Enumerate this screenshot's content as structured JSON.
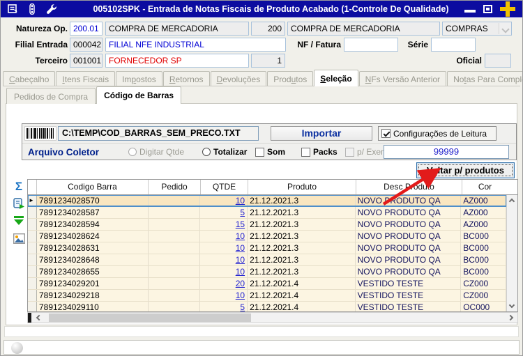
{
  "window": {
    "title": "005102SPK - Entrada de Notas Fiscais de Produto Acabado (1-Controle De Qualidade)"
  },
  "form": {
    "natureza": {
      "label": "Natureza Op.",
      "code": "200.01",
      "desc": "COMPRA DE MERCADORIA",
      "code2": "200",
      "desc2": "COMPRA DE MERCADORIA",
      "tipo": "COMPRAS"
    },
    "filial": {
      "label": "Filial Entrada",
      "code": "000042",
      "desc": "FILIAL NFE INDUSTRIAL"
    },
    "terceiro": {
      "label": "Terceiro",
      "code": "001001",
      "desc": "FORNECEDOR SP",
      "seq": "1"
    },
    "nf_fatura": {
      "label": "NF / Fatura",
      "value": ""
    },
    "serie": {
      "label": "Série",
      "value": ""
    },
    "oficial": {
      "label": "Oficial",
      "value": ""
    }
  },
  "tabs": [
    {
      "label": "Cabeçalho",
      "accel": 0,
      "name": "tab-cabecalho"
    },
    {
      "label": "Itens Fiscais",
      "accel": 0,
      "name": "tab-itens-fiscais"
    },
    {
      "label": "Impostos",
      "accel": 2,
      "name": "tab-impostos"
    },
    {
      "label": "Retornos",
      "accel": 0,
      "name": "tab-retornos"
    },
    {
      "label": "Devoluções",
      "accel": 0,
      "name": "tab-devolucoes"
    },
    {
      "label": "Produtos",
      "accel": 4,
      "name": "tab-produtos"
    },
    {
      "label": "Seleção",
      "accel": 0,
      "name": "tab-selecao",
      "active": true
    },
    {
      "label": "NFs Versão Anterior",
      "accel": 0,
      "name": "tab-nfs-versao-anterior"
    },
    {
      "label": "Notas Para Complemento",
      "accel": 2,
      "name": "tab-notas-para-complemento"
    }
  ],
  "subtabs": [
    {
      "label": "Pedidos de Compra",
      "name": "subtab-pedidos-de-compra"
    },
    {
      "label": "Código de Barras",
      "name": "subtab-codigo-de-barras",
      "active": true
    }
  ],
  "barcode_panel": {
    "path": "C:\\TEMP\\COD_BARRAS_SEM_PRECO.TXT",
    "import_label": "Importar",
    "config_label": "Configurações de Leitura",
    "config_checked": true,
    "coletor_label": "Arquivo Coletor",
    "radio_digitar": "Digitar Qtde",
    "radio_totalizar": "Totalizar",
    "check_som": "Som",
    "check_packs": "Packs",
    "check_exemplar": "p/ Exemplar",
    "quantity": "99999"
  },
  "voltar_label": "Voltar p/ produtos",
  "table": {
    "columns": [
      "Codigo Barra",
      "Pedido",
      "QTDE",
      "Produto",
      "Desc Produto",
      "Cor"
    ],
    "rows": [
      {
        "codigo": "7891234028570",
        "pedido": "",
        "qtde": "10",
        "produto": "21.12.2021.3",
        "desc": "NOVO PRODUTO QA",
        "cor": "AZ000",
        "selected": true
      },
      {
        "codigo": "7891234028587",
        "pedido": "",
        "qtde": "5",
        "produto": "21.12.2021.3",
        "desc": "NOVO PRODUTO QA",
        "cor": "AZ000"
      },
      {
        "codigo": "7891234028594",
        "pedido": "",
        "qtde": "15",
        "produto": "21.12.2021.3",
        "desc": "NOVO PRODUTO QA",
        "cor": "AZ000"
      },
      {
        "codigo": "7891234028624",
        "pedido": "",
        "qtde": "10",
        "produto": "21.12.2021.3",
        "desc": "NOVO PRODUTO QA",
        "cor": "BC000"
      },
      {
        "codigo": "7891234028631",
        "pedido": "",
        "qtde": "10",
        "produto": "21.12.2021.3",
        "desc": "NOVO PRODUTO QA",
        "cor": "BC000"
      },
      {
        "codigo": "7891234028648",
        "pedido": "",
        "qtde": "10",
        "produto": "21.12.2021.3",
        "desc": "NOVO PRODUTO QA",
        "cor": "BC000"
      },
      {
        "codigo": "7891234028655",
        "pedido": "",
        "qtde": "10",
        "produto": "21.12.2021.3",
        "desc": "NOVO PRODUTO QA",
        "cor": "BC000"
      },
      {
        "codigo": "7891234029201",
        "pedido": "",
        "qtde": "20",
        "produto": "21.12.2021.4",
        "desc": "VESTIDO TESTE",
        "cor": "CZ000"
      },
      {
        "codigo": "7891234029218",
        "pedido": "",
        "qtde": "10",
        "produto": "21.12.2021.4",
        "desc": "VESTIDO TESTE",
        "cor": "CZ000"
      },
      {
        "codigo": "7891234029110",
        "pedido": "",
        "qtde": "5",
        "produto": "21.12.2021.4",
        "desc": "VESTIDO TESTE",
        "cor": "OC000"
      }
    ]
  },
  "colors": {
    "titlebar": "#0c0ca0",
    "accent_yellow": "#f2c200",
    "row_bg": "#FCF5E2",
    "row_selected": "#F9E6C0",
    "selection_border": "#4d8fcb",
    "qty_blue": "#2020d0",
    "link_blue": "#0000d4",
    "alert_red": "#e00000",
    "navy": "#00208b",
    "arrow_red": "#e21b1b"
  }
}
